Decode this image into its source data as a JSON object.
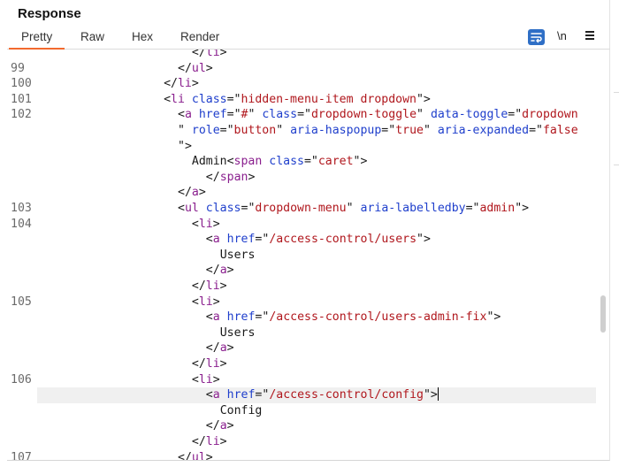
{
  "header": {
    "title": "Response"
  },
  "tabs": [
    {
      "label": "Pretty",
      "active": true
    },
    {
      "label": "Raw",
      "active": false
    },
    {
      "label": "Hex",
      "active": false
    },
    {
      "label": "Render",
      "active": false
    }
  ],
  "toolbar": {
    "wrap_icon": "word-wrap-icon",
    "newline_label": "\\n",
    "menu_icon": "hamburger-menu-icon"
  },
  "colors": {
    "accent": "#f26a2e",
    "tag": "#8a1f8e",
    "attr": "#1f3fcc",
    "value": "#b0171d",
    "active_tool": "#2f6fc6"
  },
  "code_lines": [
    {
      "num": "",
      "indent": 22,
      "segs": [
        [
          "p",
          "</"
        ],
        [
          "t",
          "li"
        ],
        [
          "p",
          ">"
        ]
      ]
    },
    {
      "num": "99",
      "indent": 20,
      "segs": [
        [
          "p",
          "</"
        ],
        [
          "t",
          "ul"
        ],
        [
          "p",
          ">"
        ]
      ]
    },
    {
      "num": "100",
      "indent": 18,
      "segs": [
        [
          "p",
          "</"
        ],
        [
          "t",
          "li"
        ],
        [
          "p",
          ">"
        ]
      ]
    },
    {
      "num": "101",
      "indent": 18,
      "segs": [
        [
          "p",
          "<"
        ],
        [
          "t",
          "li"
        ],
        [
          "p",
          " "
        ],
        [
          "a",
          "class"
        ],
        [
          "p",
          "=\""
        ],
        [
          "v",
          "hidden-menu-item dropdown"
        ],
        [
          "p",
          "\">"
        ]
      ]
    },
    {
      "num": "102",
      "indent": 20,
      "segs": [
        [
          "p",
          "<"
        ],
        [
          "t",
          "a"
        ],
        [
          "p",
          " "
        ],
        [
          "a",
          "href"
        ],
        [
          "p",
          "=\""
        ],
        [
          "v",
          "#"
        ],
        [
          "p",
          "\" "
        ],
        [
          "a",
          "class"
        ],
        [
          "p",
          "=\""
        ],
        [
          "v",
          "dropdown-toggle"
        ],
        [
          "p",
          "\" "
        ],
        [
          "a",
          "data-toggle"
        ],
        [
          "p",
          "=\""
        ],
        [
          "v",
          "dropdown"
        ]
      ]
    },
    {
      "num": "",
      "indent": 20,
      "segs": [
        [
          "p",
          "\" "
        ],
        [
          "a",
          "role"
        ],
        [
          "p",
          "=\""
        ],
        [
          "v",
          "button"
        ],
        [
          "p",
          "\" "
        ],
        [
          "a",
          "aria-haspopup"
        ],
        [
          "p",
          "=\""
        ],
        [
          "v",
          "true"
        ],
        [
          "p",
          "\" "
        ],
        [
          "a",
          "aria-expanded"
        ],
        [
          "p",
          "=\""
        ],
        [
          "v",
          "false"
        ]
      ]
    },
    {
      "num": "",
      "indent": 20,
      "segs": [
        [
          "p",
          "\">"
        ]
      ]
    },
    {
      "num": "",
      "indent": 22,
      "segs": [
        [
          "p",
          "Admin<"
        ],
        [
          "t",
          "span"
        ],
        [
          "p",
          " "
        ],
        [
          "a",
          "class"
        ],
        [
          "p",
          "=\""
        ],
        [
          "v",
          "caret"
        ],
        [
          "p",
          "\">"
        ]
      ]
    },
    {
      "num": "",
      "indent": 24,
      "segs": [
        [
          "p",
          "</"
        ],
        [
          "t",
          "span"
        ],
        [
          "p",
          ">"
        ]
      ]
    },
    {
      "num": "",
      "indent": 20,
      "segs": [
        [
          "p",
          "</"
        ],
        [
          "t",
          "a"
        ],
        [
          "p",
          ">"
        ]
      ]
    },
    {
      "num": "103",
      "indent": 20,
      "segs": [
        [
          "p",
          "<"
        ],
        [
          "t",
          "ul"
        ],
        [
          "p",
          " "
        ],
        [
          "a",
          "class"
        ],
        [
          "p",
          "=\""
        ],
        [
          "v",
          "dropdown-menu"
        ],
        [
          "p",
          "\" "
        ],
        [
          "a",
          "aria-labelledby"
        ],
        [
          "p",
          "=\""
        ],
        [
          "v",
          "admin"
        ],
        [
          "p",
          "\">"
        ]
      ]
    },
    {
      "num": "104",
      "indent": 22,
      "segs": [
        [
          "p",
          "<"
        ],
        [
          "t",
          "li"
        ],
        [
          "p",
          ">"
        ]
      ]
    },
    {
      "num": "",
      "indent": 24,
      "segs": [
        [
          "p",
          "<"
        ],
        [
          "t",
          "a"
        ],
        [
          "p",
          " "
        ],
        [
          "a",
          "href"
        ],
        [
          "p",
          "=\""
        ],
        [
          "v",
          "/access-control/users"
        ],
        [
          "p",
          "\">"
        ]
      ]
    },
    {
      "num": "",
      "indent": 26,
      "segs": [
        [
          "p",
          "Users"
        ]
      ]
    },
    {
      "num": "",
      "indent": 24,
      "segs": [
        [
          "p",
          "</"
        ],
        [
          "t",
          "a"
        ],
        [
          "p",
          ">"
        ]
      ]
    },
    {
      "num": "",
      "indent": 22,
      "segs": [
        [
          "p",
          "</"
        ],
        [
          "t",
          "li"
        ],
        [
          "p",
          ">"
        ]
      ]
    },
    {
      "num": "105",
      "indent": 22,
      "segs": [
        [
          "p",
          "<"
        ],
        [
          "t",
          "li"
        ],
        [
          "p",
          ">"
        ]
      ]
    },
    {
      "num": "",
      "indent": 24,
      "segs": [
        [
          "p",
          "<"
        ],
        [
          "t",
          "a"
        ],
        [
          "p",
          " "
        ],
        [
          "a",
          "href"
        ],
        [
          "p",
          "=\""
        ],
        [
          "v",
          "/access-control/users-admin-fix"
        ],
        [
          "p",
          "\">"
        ]
      ]
    },
    {
      "num": "",
      "indent": 26,
      "segs": [
        [
          "p",
          "Users"
        ]
      ]
    },
    {
      "num": "",
      "indent": 24,
      "segs": [
        [
          "p",
          "</"
        ],
        [
          "t",
          "a"
        ],
        [
          "p",
          ">"
        ]
      ]
    },
    {
      "num": "",
      "indent": 22,
      "segs": [
        [
          "p",
          "</"
        ],
        [
          "t",
          "li"
        ],
        [
          "p",
          ">"
        ]
      ]
    },
    {
      "num": "106",
      "indent": 22,
      "segs": [
        [
          "p",
          "<"
        ],
        [
          "t",
          "li"
        ],
        [
          "p",
          ">"
        ]
      ]
    },
    {
      "num": "",
      "indent": 24,
      "current": true,
      "segs": [
        [
          "p",
          "<"
        ],
        [
          "t",
          "a"
        ],
        [
          "p",
          " "
        ],
        [
          "a",
          "href"
        ],
        [
          "p",
          "=\""
        ],
        [
          "v",
          "/access-control/config"
        ],
        [
          "p",
          "\">"
        ]
      ]
    },
    {
      "num": "",
      "indent": 26,
      "segs": [
        [
          "p",
          "Config"
        ]
      ]
    },
    {
      "num": "",
      "indent": 24,
      "segs": [
        [
          "p",
          "</"
        ],
        [
          "t",
          "a"
        ],
        [
          "p",
          ">"
        ]
      ]
    },
    {
      "num": "",
      "indent": 22,
      "segs": [
        [
          "p",
          "</"
        ],
        [
          "t",
          "li"
        ],
        [
          "p",
          ">"
        ]
      ]
    },
    {
      "num": "107",
      "indent": 20,
      "segs": [
        [
          "p",
          "</"
        ],
        [
          "t",
          "ul"
        ],
        [
          "p",
          ">"
        ]
      ]
    }
  ]
}
